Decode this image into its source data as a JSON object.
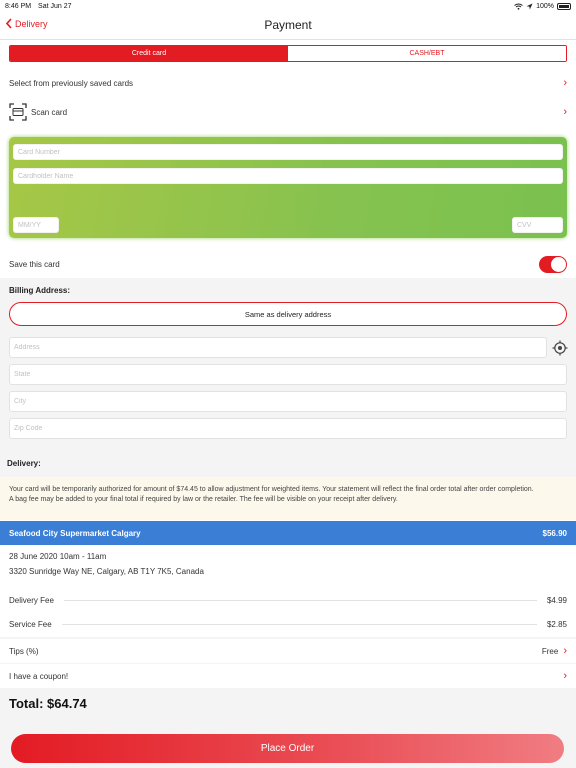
{
  "status_bar": {
    "time": "8:46 PM",
    "date": "Sat Jun 27",
    "battery": "100%"
  },
  "nav": {
    "back_label": "Delivery",
    "title": "Payment"
  },
  "payment_tabs": [
    {
      "label": "Credit card",
      "active": true
    },
    {
      "label": "CASH/EBT",
      "active": false
    }
  ],
  "saved_cards_label": "Select from previously saved cards",
  "scan_card_label": "Scan card",
  "card_form": {
    "card_number_placeholder": "Card Number",
    "cardholder_placeholder": "Cardholder Name",
    "expiry_placeholder": "MM/YY",
    "cvv_placeholder": "CVV"
  },
  "save_card": {
    "label": "Save this card",
    "enabled": true
  },
  "billing": {
    "label": "Billing Address:",
    "same_as_delivery": "Same as delivery address",
    "address_placeholder": "Address",
    "state_placeholder": "State",
    "city_placeholder": "City",
    "zip_placeholder": "Zip Code"
  },
  "delivery": {
    "label": "Delivery:",
    "notice_line1": "Your card will be temporarily authorized for amount of $74.45 to allow adjustment for weighted items. Your statement will reflect the final order total after order completion.",
    "notice_line2": "A bag fee may be added to your final total if required by law or the retailer. The fee will be visible on your receipt after delivery.",
    "store_name": "Seafood City Supermarket Calgary",
    "store_total": "$56.90",
    "slot": "28 June 2020 10am - 11am",
    "address": "3320 Sunridge Way NE, Calgary, AB T1Y 7K5, Canada"
  },
  "fees": [
    {
      "label": "Delivery Fee",
      "amount": "$4.99"
    },
    {
      "label": "Service Fee",
      "amount": "$2.85"
    }
  ],
  "tips": {
    "label": "Tips (%)",
    "value": "Free"
  },
  "coupon_label": "I have a coupon!",
  "total_label": "Total: $64.74",
  "place_order_label": "Place Order",
  "colors": {
    "accent": "#e31b23",
    "store_bar": "#3a7ed6",
    "card_green": "#86c24f"
  }
}
